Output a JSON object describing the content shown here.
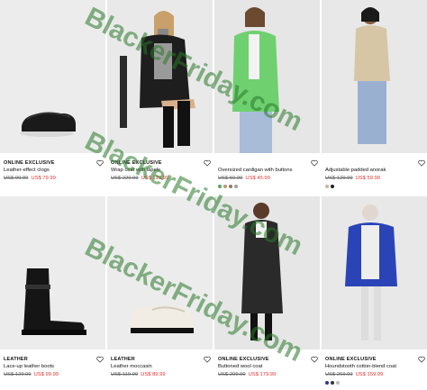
{
  "products": [
    {
      "tag": "ONLINE EXCLUSIVE",
      "name": "Leather-effect clogs",
      "old_price": "US$ 99.99",
      "new_price": "US$ 79.99",
      "swatches": []
    },
    {
      "tag": "ONLINE EXCLUSIVE",
      "name": "Wrap coat with lapels",
      "old_price": "US$ 229.99",
      "new_price": "US$ 129.99",
      "swatches": []
    },
    {
      "tag": "",
      "name": "Oversized cardigan with buttons",
      "old_price": "US$ 59.99",
      "new_price": "US$ 45.99",
      "swatches": [
        "#5aa55a",
        "#b89a7a",
        "#8a7a6a",
        "#a0a0a0"
      ]
    },
    {
      "tag": "",
      "name": "Adjustable padded anorak",
      "old_price": "US$ 129.99",
      "new_price": "US$ 59.99",
      "swatches": [
        "#c8b89c",
        "#222222"
      ]
    },
    {
      "tag": "LEATHER",
      "name": "Lace-up leather boots",
      "old_price": "US$ 129.99",
      "new_price": "US$ 99.99",
      "swatches": []
    },
    {
      "tag": "LEATHER",
      "name": "Leather moccasin",
      "old_price": "US$ 119.99",
      "new_price": "US$ 89.99",
      "swatches": []
    },
    {
      "tag": "ONLINE EXCLUSIVE",
      "name": "Buttoned wool coat",
      "old_price": "US$ 299.99",
      "new_price": "US$ 179.99",
      "swatches": []
    },
    {
      "tag": "ONLINE EXCLUSIVE",
      "name": "Houndstooth cotton-blend coat",
      "old_price": "US$ 269.99",
      "new_price": "US$ 159.99",
      "swatches": [
        "#2a3a8a",
        "#333333",
        "#bbbbbb"
      ]
    }
  ],
  "watermark": "BlackerFriday.com",
  "colors": {
    "sale": "#e03030",
    "watermark": "#287828"
  }
}
